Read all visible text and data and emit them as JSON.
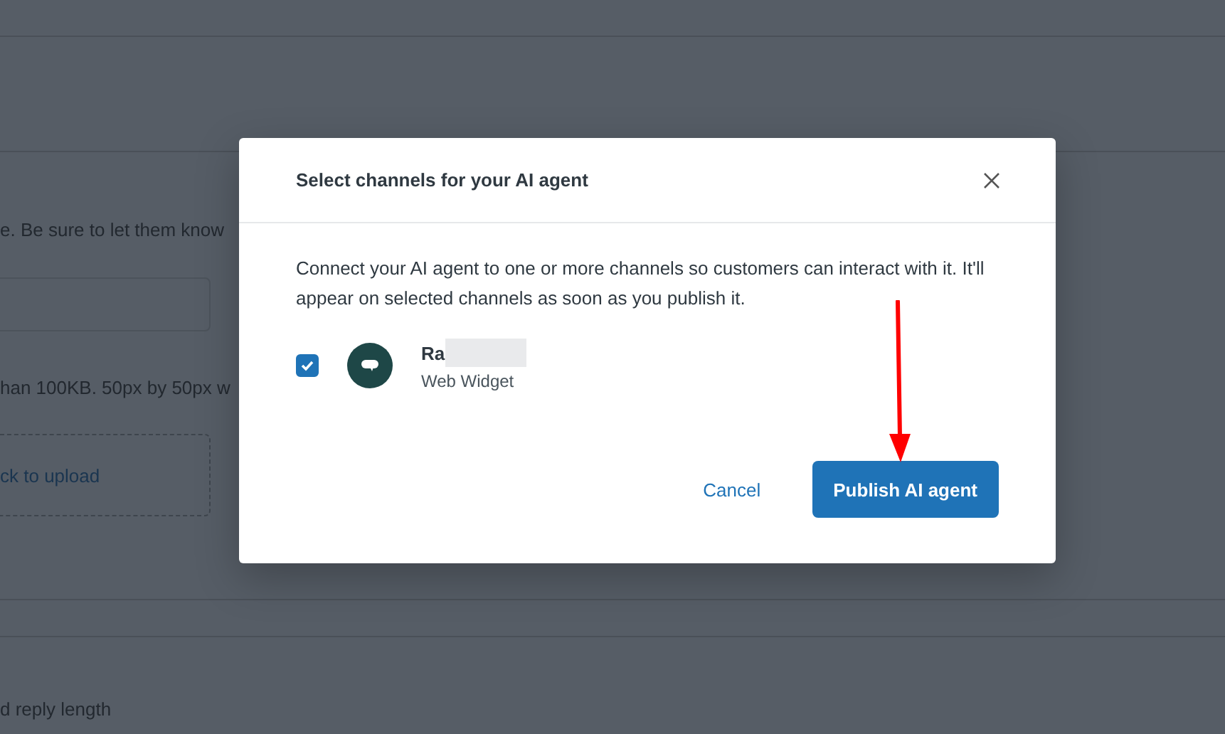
{
  "background_page": {
    "notice_text": "e. Be sure to let them know",
    "size_hint": "han 100KB. 50px by 50px w",
    "upload_text": "ck to upload",
    "reply_length_label": "d reply length"
  },
  "dialog": {
    "title": "Select channels for your AI agent",
    "description": "Connect your AI agent to one or more channels so customers can interact with it. It'll appear on selected channels as soon as you publish it.",
    "channels": [
      {
        "name": "Ra",
        "type": "Web Widget",
        "checked": true
      }
    ],
    "buttons": [
      {
        "kind": "link",
        "label": "Cancel"
      },
      {
        "kind": "primary",
        "label": "Publish AI agent"
      }
    ]
  }
}
